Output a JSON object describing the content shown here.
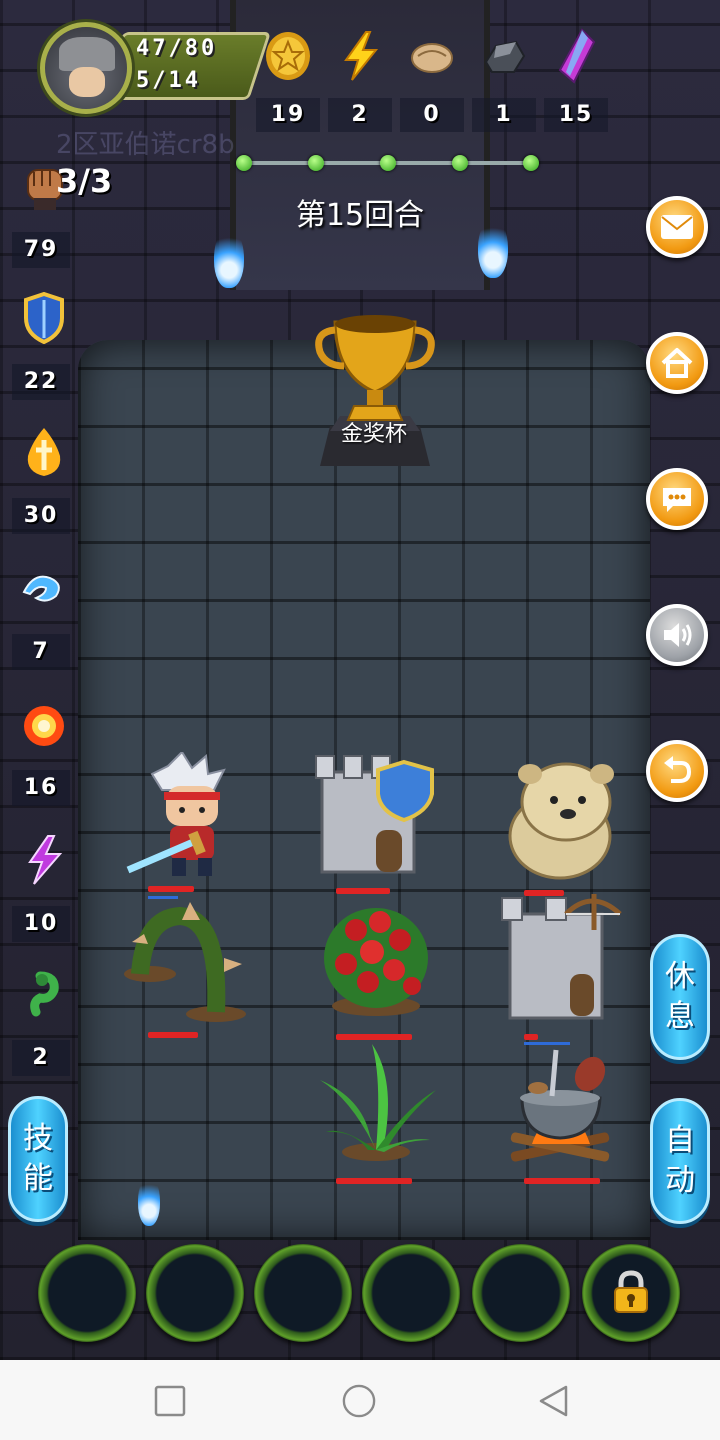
{
  "player": {
    "hp": "47/80",
    "energy": "5/14",
    "watermark": "2区亚伯诺cr8b"
  },
  "resources": [
    {
      "icon": "gold-coin-icon",
      "value": "19"
    },
    {
      "icon": "lightning-icon",
      "value": "2"
    },
    {
      "icon": "bread-icon",
      "value": "0"
    },
    {
      "icon": "iron-ore-icon",
      "value": "1"
    },
    {
      "icon": "purple-crystal-icon",
      "value": "15"
    }
  ],
  "progress": {
    "steps_total": 5,
    "steps_done": 5
  },
  "round_label": "第15回合",
  "attacks": "3/3",
  "side_stats": [
    {
      "icon": "fist-icon",
      "value": "79"
    },
    {
      "icon": "shield-icon",
      "value": "22"
    },
    {
      "icon": "holy-flame-icon",
      "value": "30"
    },
    {
      "icon": "water-wave-icon",
      "value": "7"
    },
    {
      "icon": "fire-burst-icon",
      "value": "16"
    },
    {
      "icon": "purple-lightning-icon",
      "value": "10"
    },
    {
      "icon": "green-serpent-icon",
      "value": "2"
    }
  ],
  "buttons": {
    "rest": [
      "休",
      "息"
    ],
    "auto": [
      "自",
      "动"
    ],
    "skills": [
      "技",
      "能"
    ]
  },
  "board": {
    "trophy_label": "金奖杯",
    "units": [
      {
        "name": "hero-swordsman",
        "hp": 1.0,
        "mp": 1.0
      },
      {
        "name": "shield-tower",
        "hp": 1.0
      },
      {
        "name": "chow-dog",
        "hp": 1.0
      },
      {
        "name": "thorn-vine",
        "hp": 1.0
      },
      {
        "name": "berry-bush",
        "hp": 1.0
      },
      {
        "name": "crossbow-tower",
        "hp": 0.2,
        "mp": 0.6
      },
      {
        "name": "grass-plant",
        "hp": 1.0
      },
      {
        "name": "cooking-pot-campfire",
        "hp": 1.0
      }
    ]
  },
  "colors": {
    "hp_bar": "#e02424",
    "mp_bar": "#2e6bd8",
    "accent_orange": "#f29a12",
    "pill_blue": "#3ab8f0"
  }
}
